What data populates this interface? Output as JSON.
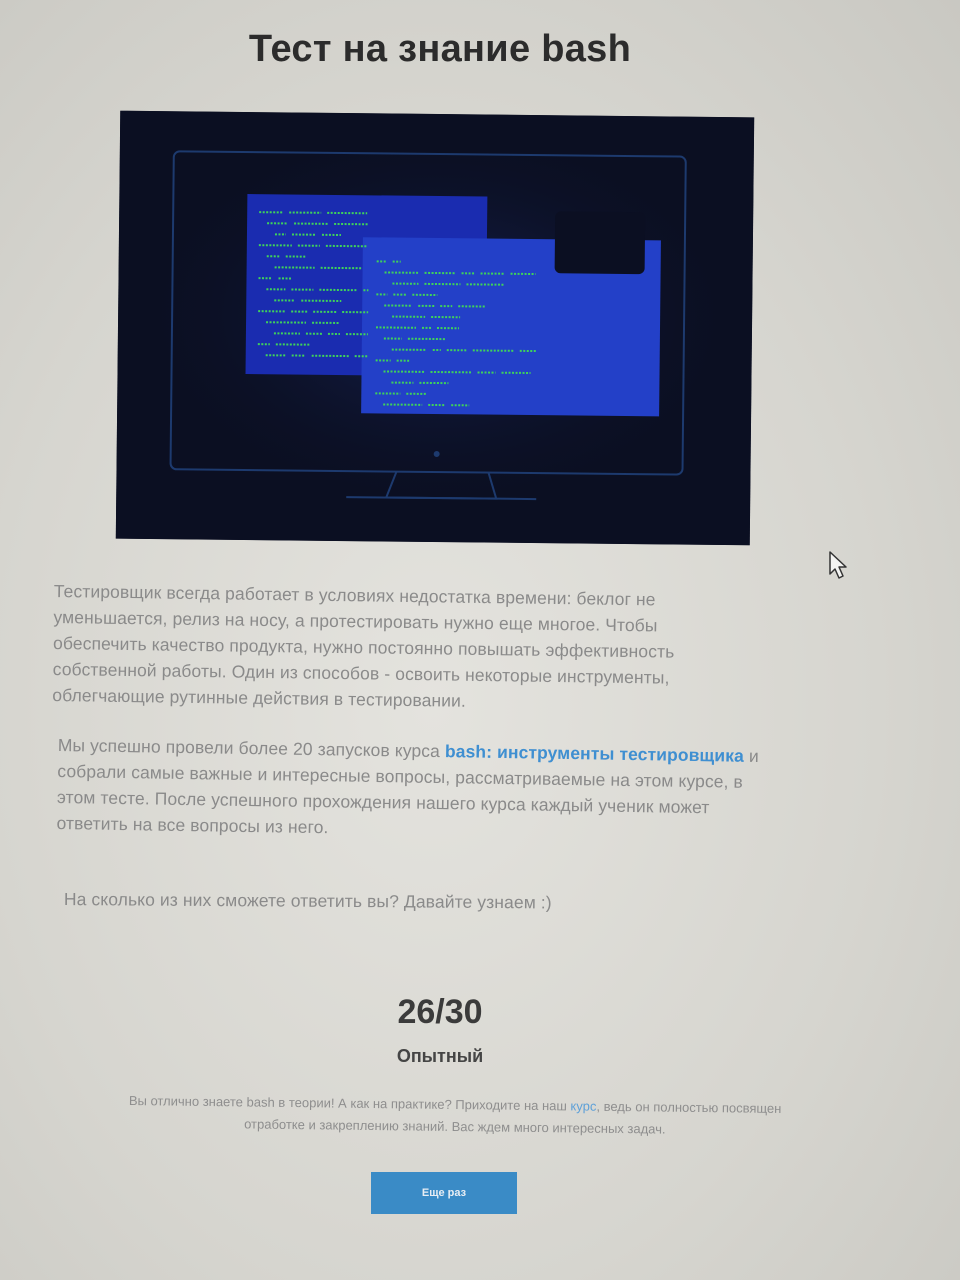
{
  "page": {
    "title": "Тест на знание bash"
  },
  "hero_image": {
    "icon": "monitor-with-terminal-windows-icon"
  },
  "intro": {
    "paragraph1": "Тестировщик всегда работает в условиях недостатка времени: беклог не уменьшается, релиз на носу, а протестировать нужно еще многое. Чтобы обеспечить качество продукта, нужно постоянно повышать эффективность собственной работы. Один из способов - освоить некоторые инструменты, облегчающие рутинные действия в тестировании.",
    "paragraph2_before": "Мы успешно провели более 20 запусков курса ",
    "paragraph2_link": "bash: инструменты тестировщика",
    "paragraph2_after": " и собрали самые важные и интересные вопросы, рассматриваемые на этом курсе, в этом тесте. После успешного прохождения нашего курса каждый ученик может ответить на все вопросы из него.",
    "paragraph3": "На сколько из них сможете ответить вы? Давайте узнаем :)"
  },
  "result": {
    "score": "26/30",
    "level": "Опытный",
    "text_before": "Вы отлично знаете bash в теории! А как на практике? Приходите на наш ",
    "text_link": "курс",
    "text_after": ", ведь он полностью посвящен отработке и закреплению знаний. Вас ждем много интересных задач.",
    "retry_label": "Еще раз"
  },
  "colors": {
    "accent": "#3a8bc6",
    "link": "#3f8fd1",
    "terminal_green": "#3fd35a",
    "terminal_blue": "#1f3fbf"
  }
}
